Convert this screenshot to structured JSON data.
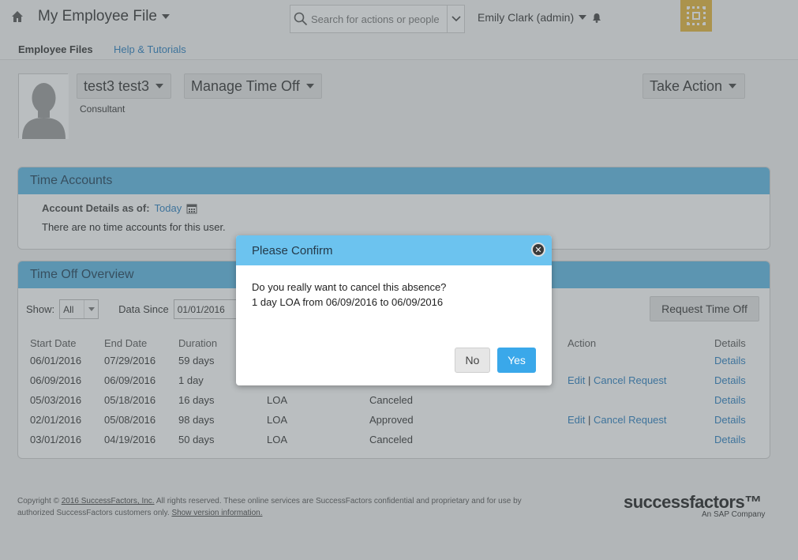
{
  "header": {
    "module_title": "My Employee File",
    "search_placeholder": "Search for actions or people",
    "user_label": "Emily Clark (admin)"
  },
  "subnav": {
    "active_tab": "Employee Files",
    "help_link": "Help & Tutorials"
  },
  "profile": {
    "name": "test3 test3",
    "job_title": "Consultant",
    "manage_label": "Manage Time Off",
    "take_action_label": "Take Action"
  },
  "time_accounts": {
    "title": "Time Accounts",
    "details_label": "Account Details as of:",
    "details_date": "Today",
    "empty_text": "There are no time accounts for this user."
  },
  "time_off": {
    "title": "Time Off Overview",
    "show_label": "Show:",
    "show_value": "All",
    "data_since_label": "Data Since",
    "data_since_value": "01/01/2016",
    "request_button": "Request Time Off",
    "columns": [
      "Start Date",
      "End Date",
      "Duration",
      "",
      "",
      "Action",
      "Details"
    ],
    "rows": [
      {
        "start": "06/01/2016",
        "end": "07/29/2016",
        "duration": "59 days",
        "type": "",
        "status": "",
        "edit": "",
        "cancel": "",
        "details": "Details"
      },
      {
        "start": "06/09/2016",
        "end": "06/09/2016",
        "duration": "1 day",
        "type": "",
        "status": "",
        "edit": "Edit",
        "cancel": "Cancel Request",
        "details": "Details"
      },
      {
        "start": "05/03/2016",
        "end": "05/18/2016",
        "duration": "16 days",
        "type": "LOA",
        "status": "Canceled",
        "edit": "",
        "cancel": "",
        "details": "Details"
      },
      {
        "start": "02/01/2016",
        "end": "05/08/2016",
        "duration": "98 days",
        "type": "LOA",
        "status": "Approved",
        "edit": "Edit",
        "cancel": "Cancel Request",
        "details": "Details"
      },
      {
        "start": "03/01/2016",
        "end": "04/19/2016",
        "duration": "50 days",
        "type": "LOA",
        "status": "Canceled",
        "edit": "",
        "cancel": "",
        "details": "Details"
      }
    ]
  },
  "footer": {
    "copyright_prefix": "Copyright ©",
    "company_link": "2016 SuccessFactors, Inc.",
    "text_1": "All rights reserved. These online services are SuccessFactors confidential and proprietary and for use by",
    "text_2": "authorized SuccessFactors customers only.",
    "version_link": "Show version information.",
    "logo_text": "successfactors™",
    "logo_sub": "An SAP Company"
  },
  "dialog": {
    "title": "Please Confirm",
    "close_glyph": "✕",
    "line_1": "Do you really want to cancel this absence?",
    "line_2": "1 day LOA from 06/09/2016 to 06/09/2016",
    "no_label": "No",
    "yes_label": "Yes"
  },
  "colors": {
    "panel_header": "#5eb8e6",
    "dialog_header": "#6cc3ef",
    "primary_button": "#3aa8ea",
    "link": "#2a7fc0",
    "logo": "#e6b53a"
  }
}
